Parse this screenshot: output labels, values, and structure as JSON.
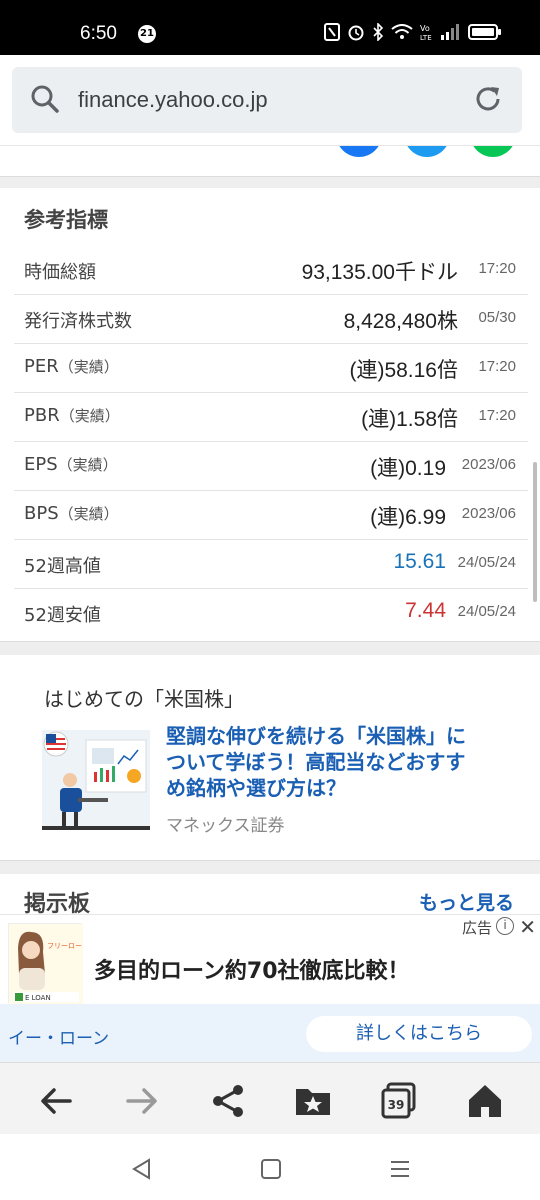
{
  "status": {
    "time": "6:50",
    "notif_count": "21"
  },
  "url": {
    "text": "finance.yahoo.co.jp"
  },
  "colors": {
    "accent_blue": "#1a73b8",
    "accent_red": "#cc3333",
    "link_blue": "#1a5fb4"
  },
  "indicators": {
    "title": "参考指標",
    "rows": [
      {
        "label": "時価総額",
        "sub": "",
        "value": "93,135.00千ドル",
        "date": "17:20"
      },
      {
        "label": "発行済株式数",
        "sub": "",
        "value": "8,428,480株",
        "date": "05/30"
      },
      {
        "label": "PER",
        "sub": "（実績）",
        "value": "(連)58.16倍",
        "date": "17:20"
      },
      {
        "label": "PBR",
        "sub": "（実績）",
        "value": "(連)1.58倍",
        "date": "17:20"
      },
      {
        "label": "EPS",
        "sub": "（実績）",
        "value": "(連)0.19",
        "date": "2023/06"
      },
      {
        "label": "BPS",
        "sub": "（実績）",
        "value": "(連)6.99",
        "date": "2023/06"
      },
      {
        "label": "52週高値",
        "sub": "",
        "value": "15.61",
        "date": "24/05/24"
      },
      {
        "label": "52週安値",
        "sub": "",
        "value": "7.44",
        "date": "24/05/24"
      }
    ]
  },
  "ad_card": {
    "title": "はじめての「米国株」",
    "headline": "堅調な伸びを続ける「米国株」について学ぼう！高配当などおすすめ銘柄や選び方は？",
    "sponsor": "マネックス証券"
  },
  "board": {
    "title": "掲示板",
    "more": "もっと見る"
  },
  "banner": {
    "thumb_text": "フリーローン 徹底比較",
    "thumb_brand": "E LOAN",
    "text": "多目的ローン約70社徹底比較！",
    "ad_label": "広告",
    "brand": "イー・ローン",
    "cta": "詳しくはこちら"
  },
  "navbar": {
    "tabs_count": "39"
  }
}
